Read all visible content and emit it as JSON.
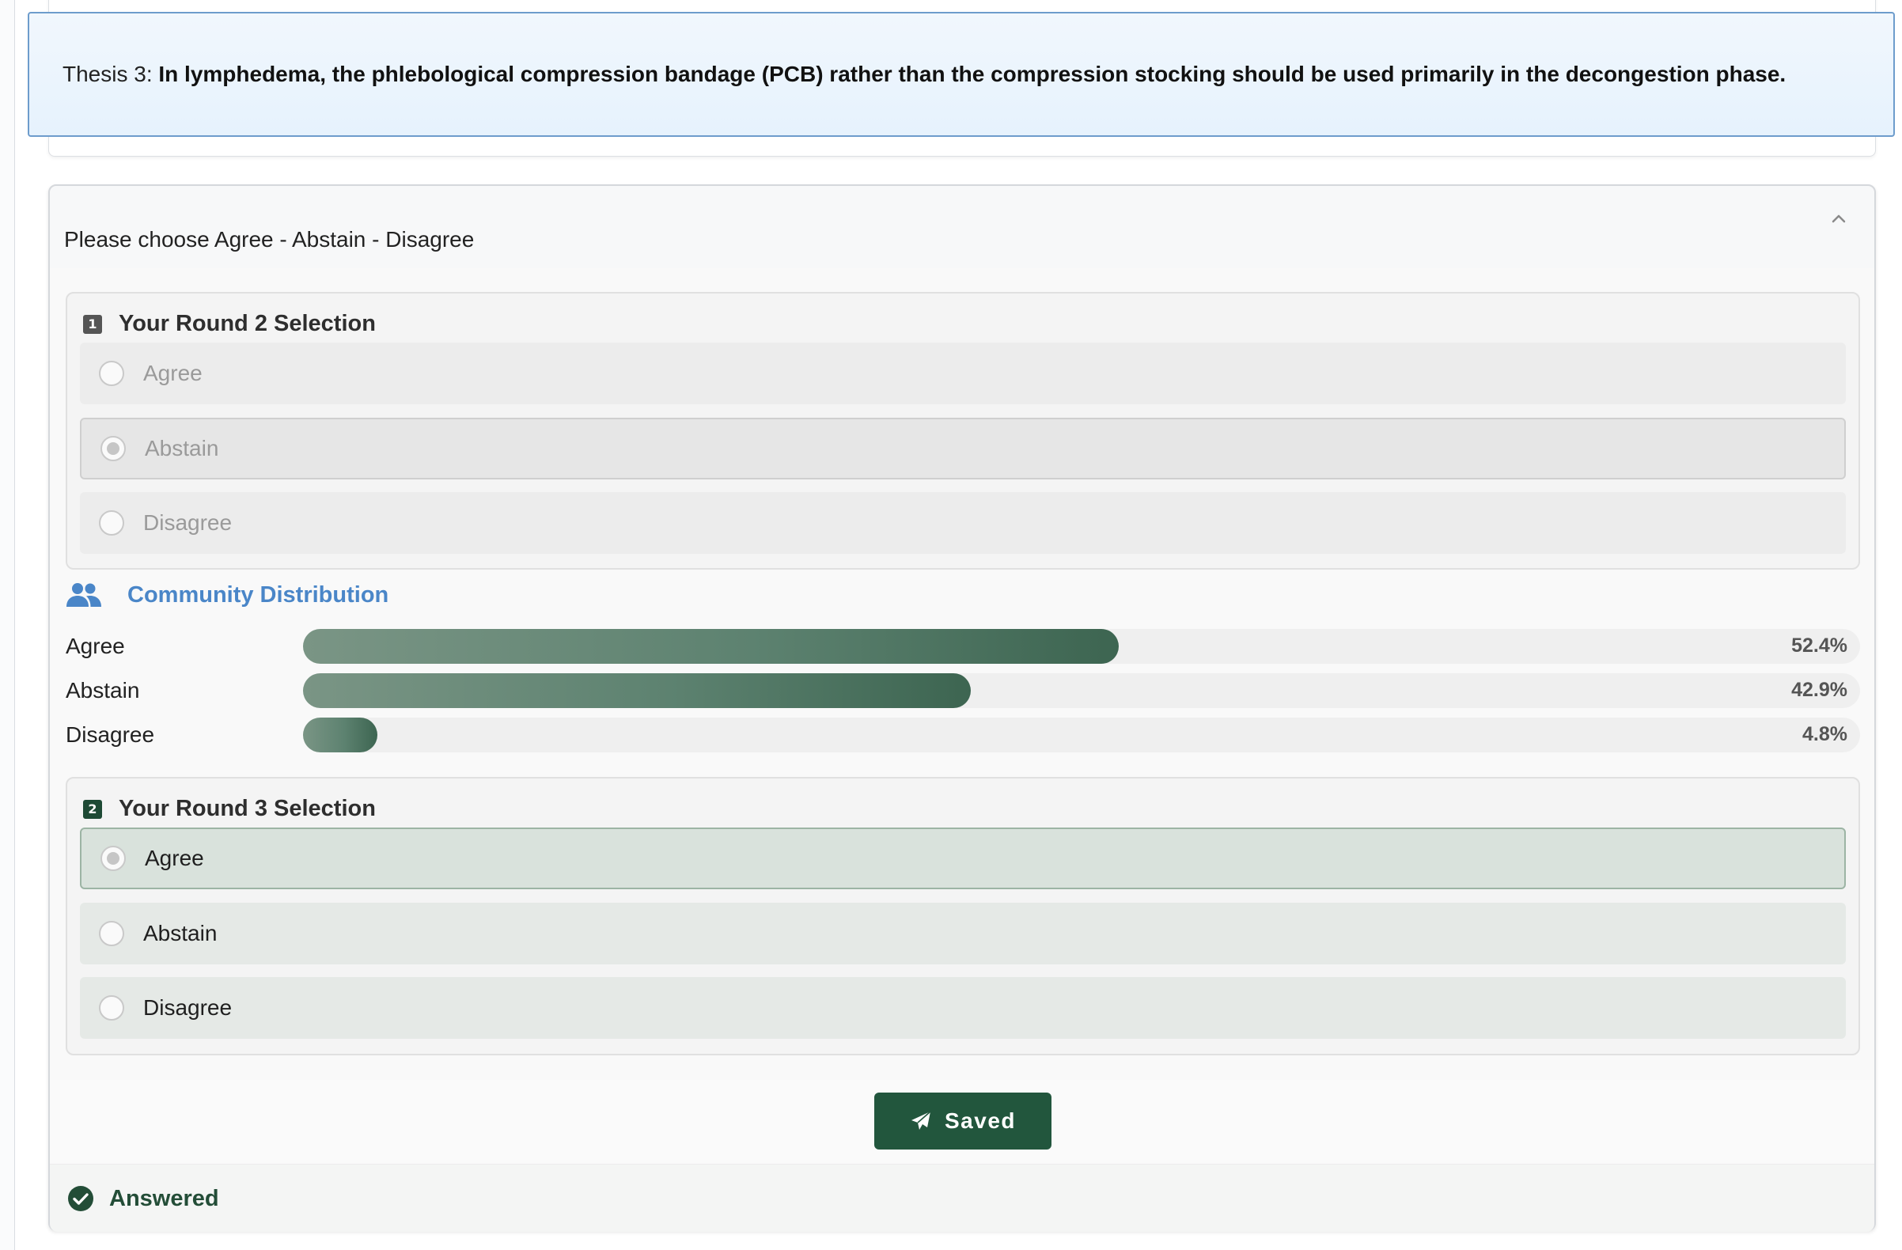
{
  "thesis": {
    "prefix": "Thesis 3:",
    "text": "In lymphedema, the phlebological compression bandage (PCB) rather than the compression stocking should be used primarily in the decongestion phase."
  },
  "question": {
    "prompt": "Please choose Agree - Abstain - Disagree",
    "collapse_icon": "chevron-up-icon"
  },
  "round2": {
    "badge": "1",
    "title": "Your Round 2 Selection",
    "selected": "Abstain",
    "options": [
      "Agree",
      "Abstain",
      "Disagree"
    ]
  },
  "community": {
    "title": "Community Distribution",
    "icon": "users-icon",
    "rows": [
      {
        "label": "Agree",
        "percent_text": "52.4%",
        "value": 52.4
      },
      {
        "label": "Abstain",
        "percent_text": "42.9%",
        "value": 42.9
      },
      {
        "label": "Disagree",
        "percent_text": "4.8%",
        "value": 4.8
      }
    ]
  },
  "round3": {
    "badge": "2",
    "title": "Your Round 3 Selection",
    "selected": "Agree",
    "options": [
      "Agree",
      "Abstain",
      "Disagree"
    ]
  },
  "actions": {
    "saved_label": "Saved",
    "saved_icon": "paper-plane-icon"
  },
  "status": {
    "label": "Answered",
    "icon": "check-circle-icon"
  },
  "colors": {
    "primary_green": "#22563d",
    "link_blue": "#4a86c8",
    "banner_border": "#6d9ccc"
  }
}
